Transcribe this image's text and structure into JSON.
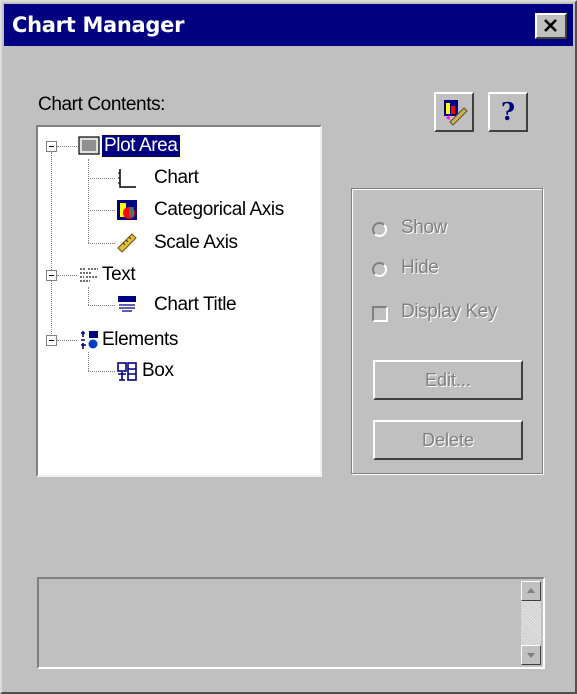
{
  "window": {
    "title": "Chart Manager"
  },
  "toolbar": {
    "icon_button_icon": "chart-wizard-icon",
    "help_label": "?"
  },
  "contents_label": "Chart Contents:",
  "tree": {
    "plot_area": "Plot Area",
    "chart": "Chart",
    "categorical_axis": "Categorical Axis",
    "scale_axis": "Scale Axis",
    "text": "Text",
    "chart_title": "Chart Title",
    "elements": "Elements",
    "box": "Box"
  },
  "options": {
    "show_label": "Show",
    "hide_label": "Hide",
    "display_key_label": "Display Key",
    "edit_label": "Edit...",
    "delete_label": "Delete"
  },
  "colors": {
    "title_bar": "#000080",
    "face": "#c0c0c0",
    "selection": "#000080",
    "disabled_text": "#808080"
  }
}
